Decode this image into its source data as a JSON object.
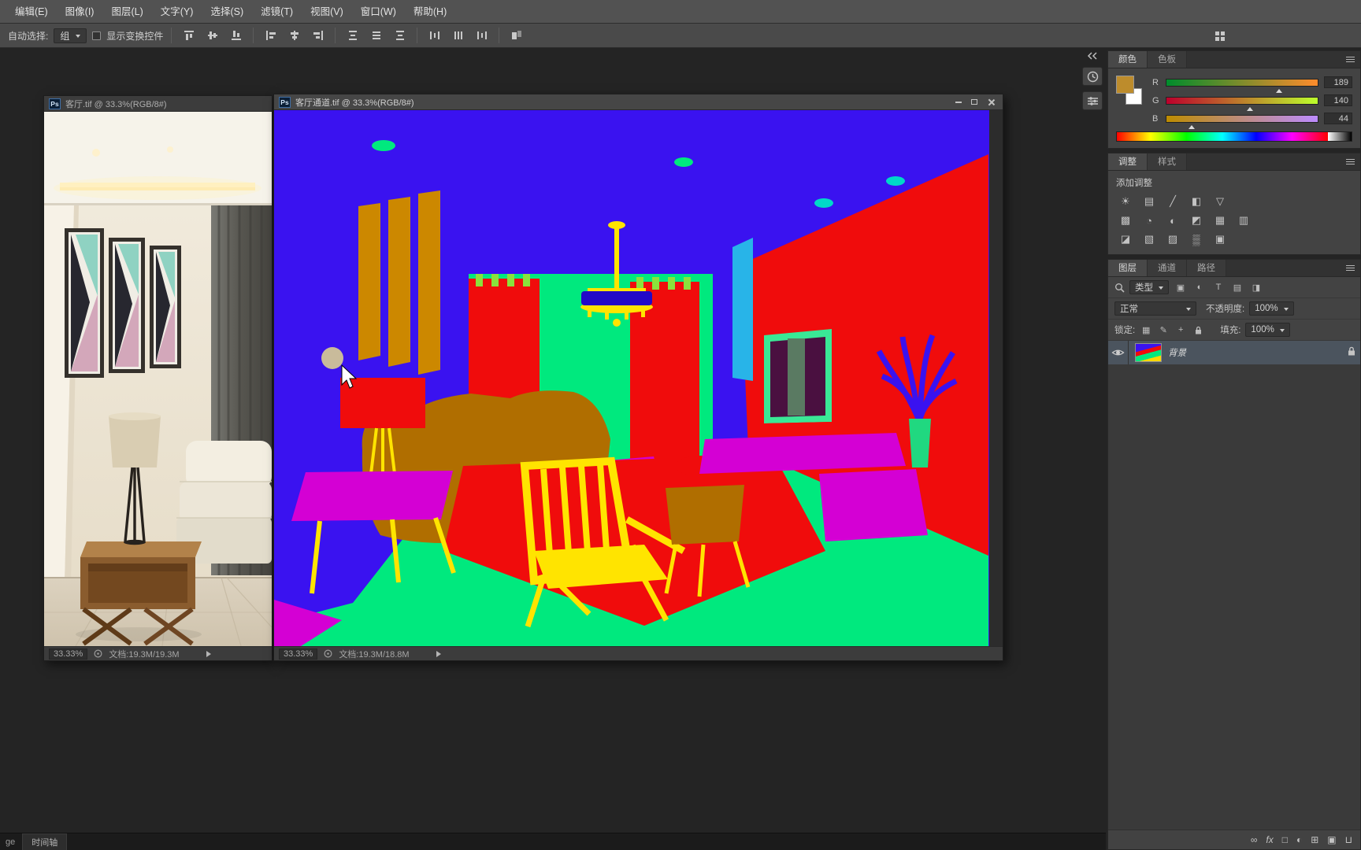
{
  "menu_bar": {
    "items": [
      {
        "label": "编辑(E)"
      },
      {
        "label": "图像(I)"
      },
      {
        "label": "图层(L)"
      },
      {
        "label": "文字(Y)"
      },
      {
        "label": "选择(S)"
      },
      {
        "label": "滤镜(T)"
      },
      {
        "label": "视图(V)"
      },
      {
        "label": "窗口(W)"
      },
      {
        "label": "帮助(H)"
      }
    ]
  },
  "options_bar": {
    "auto_select_label": "自动选择:",
    "auto_select_value": "组",
    "show_transform_label": "显示变换控件"
  },
  "doc_left": {
    "icon": "Ps",
    "title": "客厅.tif @ 33.3%(RGB/8#)",
    "zoom": "33.33%",
    "doc_info": "文档:19.3M/19.3M"
  },
  "doc_right": {
    "icon": "Ps",
    "title": "客厅通道.tif @ 33.3%(RGB/8#)",
    "zoom": "33.33%",
    "doc_info": "文档:19.3M/18.8M"
  },
  "color_panel": {
    "tabs": [
      {
        "label": "颜色"
      },
      {
        "label": "色板"
      }
    ],
    "swatch_style": "background:#bd8c2c",
    "foreground_hex": "#bd8c2c",
    "channels": [
      {
        "label": "R",
        "value": "189"
      },
      {
        "label": "G",
        "value": "140"
      },
      {
        "label": "B",
        "value": "44"
      }
    ]
  },
  "adjustments_panel": {
    "tabs": [
      {
        "label": "调整"
      },
      {
        "label": "样式"
      }
    ],
    "title": "添加调整",
    "icons": [
      {
        "name": "brightness-contrast",
        "glyph": "☀"
      },
      {
        "name": "levels",
        "glyph": "▤"
      },
      {
        "name": "curves",
        "glyph": "╱"
      },
      {
        "name": "exposure",
        "glyph": "◧"
      },
      {
        "name": "vibrance",
        "glyph": "▽"
      },
      {
        "name": "hue-saturation",
        "glyph": "▩"
      },
      {
        "name": "color-balance",
        "glyph": "◔"
      },
      {
        "name": "black-white",
        "glyph": "◐"
      },
      {
        "name": "photo-filter",
        "glyph": "◩"
      },
      {
        "name": "channel-mixer",
        "glyph": "▦"
      },
      {
        "name": "color-lookup",
        "glyph": "▥"
      },
      {
        "name": "invert",
        "glyph": "◪"
      },
      {
        "name": "posterize",
        "glyph": "▧"
      },
      {
        "name": "threshold",
        "glyph": "▨"
      },
      {
        "name": "gradient-map",
        "glyph": "▒"
      },
      {
        "name": "selective-color",
        "glyph": "▣"
      }
    ]
  },
  "layers_panel": {
    "tabs": [
      {
        "label": "图层"
      },
      {
        "label": "通道"
      },
      {
        "label": "路径"
      }
    ],
    "filter_label": "类型",
    "filter_icons": [
      {
        "glyph": "▣"
      },
      {
        "glyph": "◐"
      },
      {
        "glyph": "T"
      },
      {
        "glyph": "▤"
      },
      {
        "glyph": "◨"
      }
    ],
    "blend_mode": "正常",
    "opacity_label": "不透明度:",
    "opacity_value": "100%",
    "lock_label": "锁定:",
    "lock_icons": [
      {
        "glyph": "▦"
      },
      {
        "glyph": "✎"
      },
      {
        "glyph": "+"
      }
    ],
    "fill_label": "填充:",
    "fill_value": "100%",
    "layers": [
      {
        "name": "背景"
      }
    ],
    "footer_icons": [
      {
        "name": "link-layers-icon",
        "glyph": "∞"
      },
      {
        "name": "layer-style-icon",
        "glyph": "fx"
      },
      {
        "name": "add-layer-mask-icon",
        "glyph": "□"
      },
      {
        "name": "new-adjustment-layer-icon",
        "glyph": "◐"
      },
      {
        "name": "new-group-icon",
        "glyph": "⊞"
      },
      {
        "name": "new-layer-icon",
        "glyph": "▣"
      },
      {
        "name": "delete-layer-icon",
        "glyph": "⊔"
      }
    ]
  },
  "bottom_bar": {
    "corner_label": "ge",
    "timeline_tab": "时间轴"
  },
  "channel_palette": {
    "blue": "#3a12f0",
    "green": "#00e97e",
    "red": "#f00c0c",
    "yellow": "#ffe400",
    "orange": "#b06e00",
    "magenta": "#d400d4",
    "cyan": "#28b4e8"
  }
}
